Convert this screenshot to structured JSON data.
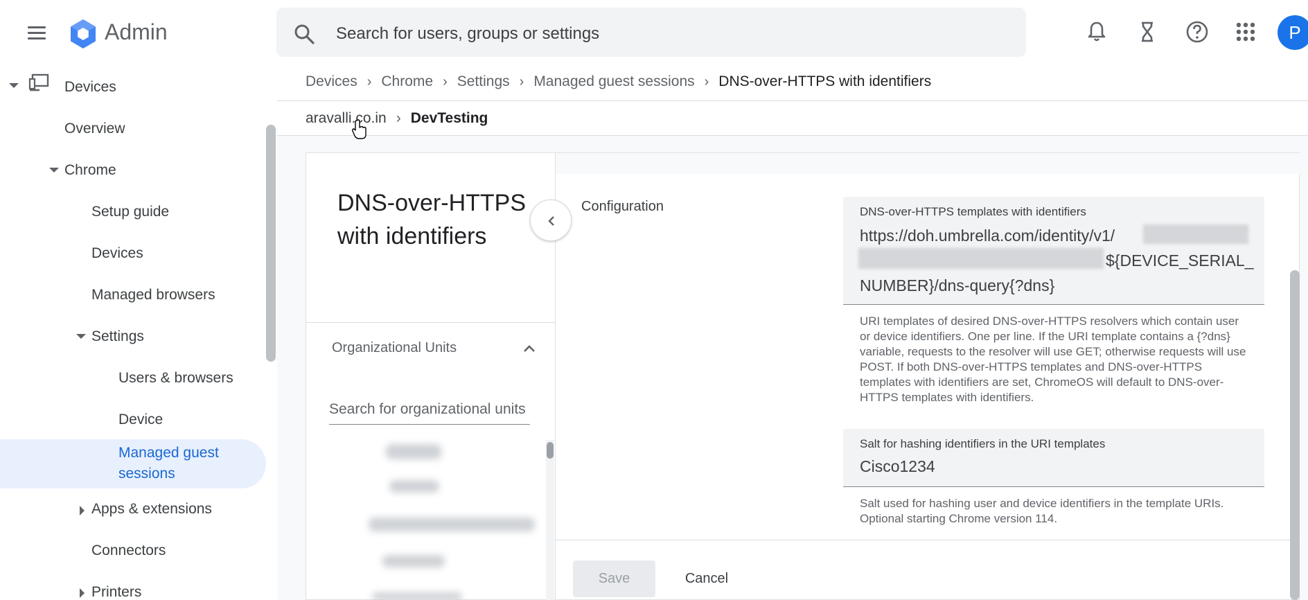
{
  "header": {
    "app_title": "Admin",
    "search_placeholder": "Search for users, groups or settings",
    "avatar_initial": "P",
    "icons": [
      "menu-icon",
      "search-icon",
      "notifications-icon",
      "hourglass-icon",
      "help-icon",
      "apps-grid-icon"
    ]
  },
  "sidebar": {
    "items": [
      {
        "label": "Devices"
      },
      {
        "label": "Overview"
      },
      {
        "label": "Chrome"
      },
      {
        "label": "Setup guide"
      },
      {
        "label": "Devices"
      },
      {
        "label": "Managed browsers"
      },
      {
        "label": "Settings"
      },
      {
        "label": "Users & browsers"
      },
      {
        "label": "Device"
      },
      {
        "label": "Managed guest sessions"
      },
      {
        "label": "Apps & extensions"
      },
      {
        "label": "Connectors"
      },
      {
        "label": "Printers"
      }
    ],
    "active_color": "#1967d2"
  },
  "breadcrumb": [
    "Devices",
    "Chrome",
    "Settings",
    "Managed guest sessions",
    "DNS-over-HTTPS with identifiers"
  ],
  "ou_breadcrumb": {
    "root": "aravalli.co.in",
    "current": "DevTesting"
  },
  "left_panel": {
    "title": "DNS-over-HTTPS with identifiers",
    "ou_heading": "Organizational Units",
    "ou_search_placeholder": "Search for organizational units"
  },
  "config": {
    "section_label": "Configuration",
    "templates_field": {
      "label": "DNS-over-HTTPS templates with identifiers",
      "value_line1": "https://doh.umbrella.com/identity/v1/",
      "value_line2": "${DEVICE_SERIAL_",
      "value_line3": "NUMBER}/dns-query{?dns}",
      "help": "URI templates of desired DNS-over-HTTPS resolvers which contain user or device identifiers. One per line. If the URI template contains a {?dns} variable, requests to the resolver will use GET; otherwise requests will use POST. If both DNS-over-HTTPS templates and DNS-over-HTTPS templates with identifiers are set, ChromeOS will default to DNS-over-HTTPS templates with identifiers."
    },
    "salt_field": {
      "label": "Salt for hashing identifiers in the URI templates",
      "value": "Cisco1234",
      "help": "Salt used for hashing user and device identifiers in the template URIs. Optional starting Chrome version 114."
    }
  },
  "actions": {
    "save_label": "Save",
    "cancel_label": "Cancel"
  },
  "colors": {
    "accent": "#1a73e8",
    "active_bg": "#e8f0fe"
  }
}
